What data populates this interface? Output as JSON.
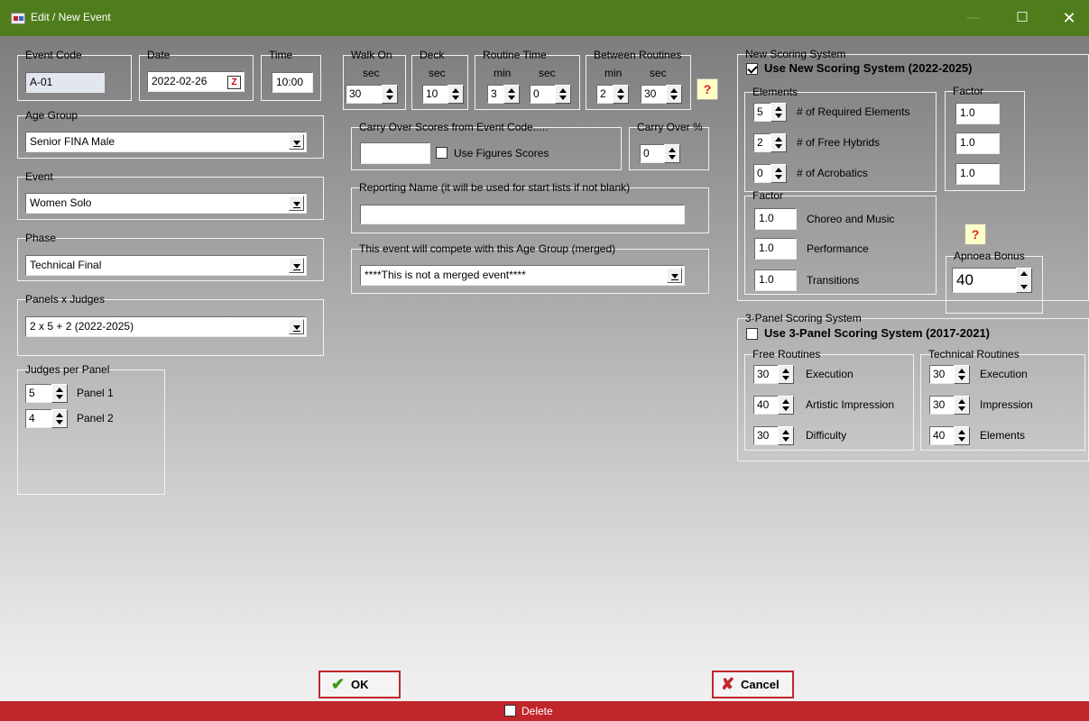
{
  "window": {
    "title": "Edit / New Event",
    "minimize": "—",
    "maximize": "☐",
    "close": "✕"
  },
  "event_code": {
    "legend": "Event Code",
    "value": "A-01"
  },
  "date": {
    "legend": "Date",
    "value": "2022-02-26",
    "button": "Z"
  },
  "time": {
    "legend": "Time",
    "value": "10:00"
  },
  "age_group": {
    "legend": "Age Group",
    "value": "Senior FINA Male"
  },
  "event": {
    "legend": "Event",
    "value": "Women Solo"
  },
  "phase": {
    "legend": "Phase",
    "value": "Technical Final"
  },
  "panels": {
    "legend": "Panels x Judges",
    "value": "2 x 5 + 2 (2022-2025)"
  },
  "judges_per_panel": {
    "legend": "Judges per Panel",
    "panel1": {
      "value": "5",
      "label": "Panel 1"
    },
    "panel2": {
      "value": "4",
      "label": "Panel 2"
    }
  },
  "walk_on": {
    "legend": "Walk On",
    "unit": "sec",
    "value": "30"
  },
  "deck": {
    "legend": "Deck",
    "unit": "sec",
    "value": "10"
  },
  "routine_time": {
    "legend": "Routine Time",
    "min_label": "min",
    "sec_label": "sec",
    "min": "3",
    "sec": "0"
  },
  "between_routines": {
    "legend": "Between Routines",
    "min_label": "min",
    "sec_label": "sec",
    "min": "2",
    "sec": "30"
  },
  "help_mark": "?",
  "carry_over": {
    "legend": "Carry Over Scores from Event Code.....",
    "value": "",
    "figures_label": "Use Figures Scores"
  },
  "carry_over_pct": {
    "legend": "Carry Over %",
    "value": "0"
  },
  "reporting_name": {
    "legend": "Reporting Name (it will be used for start lists if not blank)",
    "value": ""
  },
  "merged": {
    "legend": "This event will compete with this Age Group (merged)",
    "value": "****This is not a merged event****"
  },
  "new_scoring": {
    "legend": "New Scoring System",
    "checkbox_label": "Use New Scoring System (2022-2025)",
    "elements_legend": "Elements",
    "required": {
      "value": "5",
      "label": "# of Required Elements"
    },
    "hybrids": {
      "value": "2",
      "label": "# of Free Hybrids"
    },
    "acrobatics": {
      "value": "0",
      "label": "# of Acrobatics"
    },
    "factor_legend": "Factor",
    "factors_right": [
      "1.0",
      "1.0",
      "1.0"
    ],
    "factor2_legend": "Factor",
    "choreo": {
      "value": "1.0",
      "label": "Choreo and Music"
    },
    "performance": {
      "value": "1.0",
      "label": "Performance"
    },
    "transitions": {
      "value": "1.0",
      "label": "Transitions"
    },
    "apnoea": {
      "legend": "Apnoea Bonus",
      "value": "40"
    }
  },
  "three_panel": {
    "legend": "3-Panel Scoring System",
    "checkbox_label": "Use 3-Panel Scoring System (2017-2021)",
    "free_legend": "Free Routines",
    "free_execution": {
      "value": "30",
      "label": "Execution"
    },
    "free_artistic": {
      "value": "40",
      "label": "Artistic Impression"
    },
    "free_difficulty": {
      "value": "30",
      "label": "Difficulty"
    },
    "tech_legend": "Technical Routines",
    "tech_execution": {
      "value": "30",
      "label": "Execution"
    },
    "tech_impression": {
      "value": "30",
      "label": "Impression"
    },
    "tech_elements": {
      "value": "40",
      "label": "Elements"
    }
  },
  "buttons": {
    "ok": "OK",
    "cancel": "Cancel",
    "ok_icon": "✔",
    "cancel_icon": "✘"
  },
  "footer": {
    "delete_label": "Delete"
  },
  "colors": {
    "titlebar": "#4f7d1b",
    "footer": "#c0262c"
  }
}
